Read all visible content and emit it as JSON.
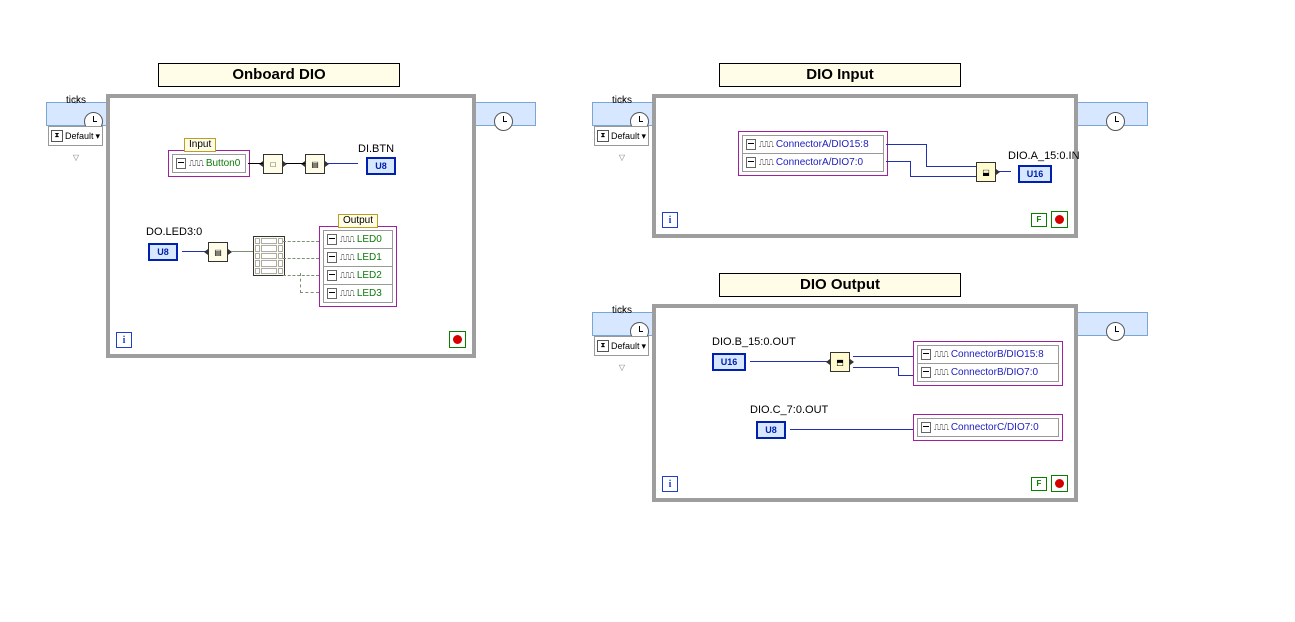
{
  "titles": {
    "onboard": "Onboard DIO",
    "input": "DIO Input",
    "output": "DIO Output"
  },
  "loop": {
    "ticks": "ticks",
    "default": "Default",
    "i": "i",
    "f": "F"
  },
  "onboard": {
    "group_in": "Input",
    "group_out": "Output",
    "button0": "Button0",
    "di_btn_lbl": "DI.BTN",
    "di_btn_type": "U8",
    "do_led_lbl": "DO.LED3:0",
    "do_led_type": "U8",
    "leds": [
      "LED0",
      "LED1",
      "LED2",
      "LED3"
    ]
  },
  "dinput": {
    "conn_hi": "ConnectorA/DIO15:8",
    "conn_lo": "ConnectorA/DIO7:0",
    "out_lbl": "DIO.A_15:0.IN",
    "out_type": "U16"
  },
  "doutput": {
    "b_lbl": "DIO.B_15:0.OUT",
    "b_type": "U16",
    "conn_b_hi": "ConnectorB/DIO15:8",
    "conn_b_lo": "ConnectorB/DIO7:0",
    "c_lbl": "DIO.C_7:0.OUT",
    "c_type": "U8",
    "conn_c": "ConnectorC/DIO7:0"
  }
}
